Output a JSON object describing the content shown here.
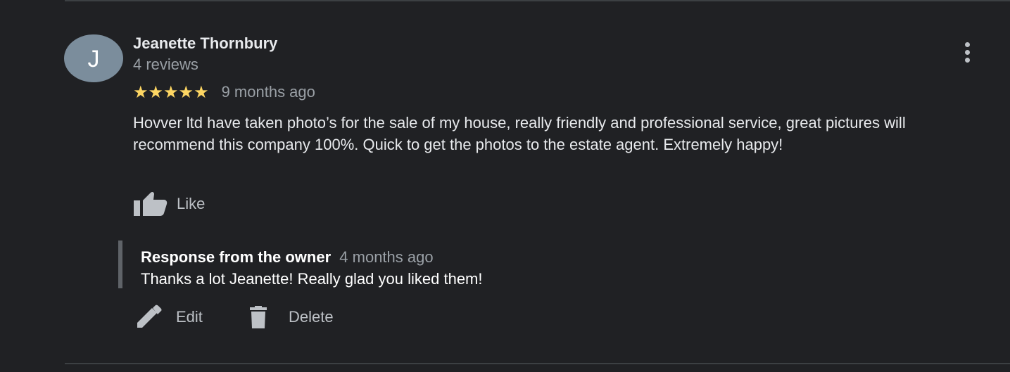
{
  "review": {
    "avatar_letter": "J",
    "author": "Jeanette Thornbury",
    "review_count": "4 reviews",
    "stars": "★★★★★",
    "rating": 5,
    "date": "9 months ago",
    "text": "Hovver ltd have taken photo’s for the sale of my house, really friendly and professional service, great pictures will recommend this company 100%. Quick to get the photos to the estate agent. Extremely happy!",
    "like_label": "Like"
  },
  "response": {
    "title": "Response from the owner",
    "date": "4 months ago",
    "text": "Thanks a lot Jeanette! Really glad you liked them!"
  },
  "actions": {
    "edit_label": "Edit",
    "delete_label": "Delete"
  },
  "colors": {
    "background": "#202124",
    "star": "#fdd663",
    "avatar": "#7b8d9c",
    "muted_text": "#9aa0a6",
    "icon": "#bdc1c6"
  },
  "icons": {
    "more": "more-vert-icon",
    "like": "thumb-up-icon",
    "edit": "pencil-icon",
    "delete": "trash-icon"
  }
}
